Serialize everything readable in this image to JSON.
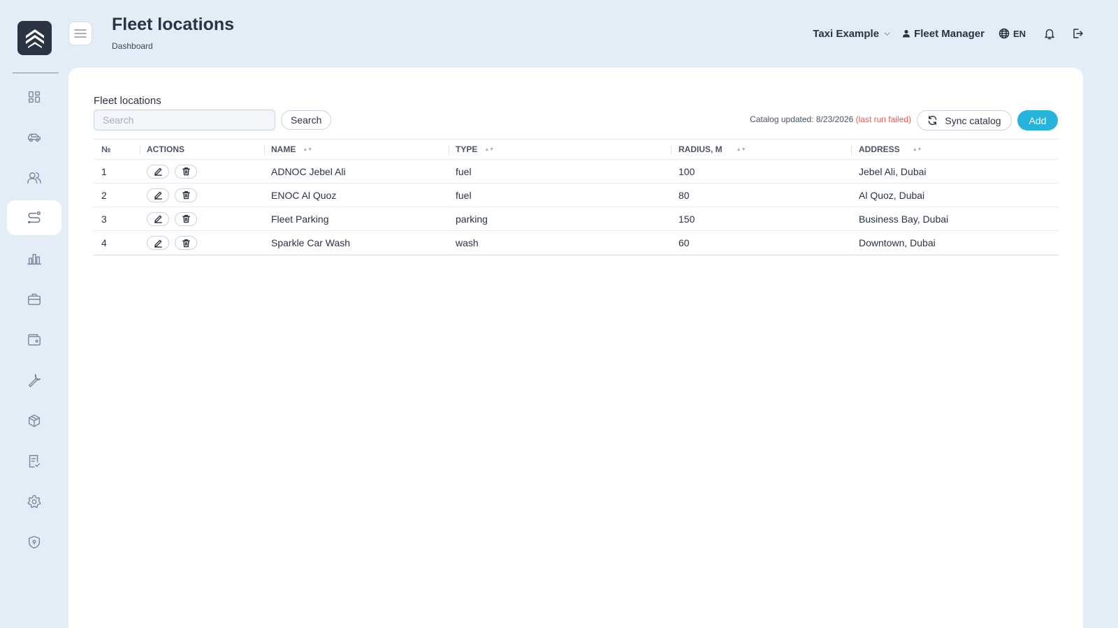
{
  "header": {
    "title": "Fleet locations",
    "breadcrumb": "Dashboard",
    "organization": "Taxi Example",
    "user_role": "Fleet Manager",
    "language": "EN"
  },
  "sidebar": {
    "items": [
      {
        "name": "dashboard",
        "icon": "dashboard-grid-icon",
        "active": false
      },
      {
        "name": "vehicles",
        "icon": "car-icon",
        "active": false
      },
      {
        "name": "drivers",
        "icon": "users-icon",
        "active": false
      },
      {
        "name": "locations",
        "icon": "route-icon",
        "active": true
      },
      {
        "name": "reports",
        "icon": "bar-chart-icon",
        "active": false
      },
      {
        "name": "jobs",
        "icon": "briefcase-icon",
        "active": false
      },
      {
        "name": "wallet",
        "icon": "wallet-icon",
        "active": false
      },
      {
        "name": "maintenance",
        "icon": "wrench-icon",
        "active": false
      },
      {
        "name": "inventory",
        "icon": "box-icon",
        "active": false
      },
      {
        "name": "documents",
        "icon": "checklist-icon",
        "active": false
      },
      {
        "name": "settings",
        "icon": "gear-icon",
        "active": false
      },
      {
        "name": "security",
        "icon": "shield-icon",
        "active": false
      }
    ]
  },
  "main": {
    "section_label": "Fleet locations",
    "search_placeholder": "Search",
    "search_button": "Search",
    "catalog_status": "Catalog updated: 8/23/2026",
    "catalog_failed": "(last run failed)",
    "sync_button": "Sync catalog",
    "add_button": "Add",
    "table": {
      "columns": [
        "№",
        "ACTIONS",
        "NAME",
        "TYPE",
        "RADIUS, M",
        "ADDRESS"
      ],
      "rows": [
        {
          "no": "1",
          "name": "ADNOC Jebel Ali",
          "type": "fuel",
          "radius": "100",
          "address": "Jebel Ali, Dubai"
        },
        {
          "no": "2",
          "name": "ENOC Al Quoz",
          "type": "fuel",
          "radius": "80",
          "address": "Al Quoz, Dubai"
        },
        {
          "no": "3",
          "name": "Fleet Parking",
          "type": "parking",
          "radius": "150",
          "address": "Business Bay, Dubai"
        },
        {
          "no": "4",
          "name": "Sparkle Car Wash",
          "type": "wash",
          "radius": "60",
          "address": "Downtown, Dubai"
        }
      ]
    }
  },
  "colors": {
    "background": "#e3edf8",
    "accent": "#26b3dc",
    "error": "#e85a4f",
    "logo_bg": "#2b3442"
  }
}
